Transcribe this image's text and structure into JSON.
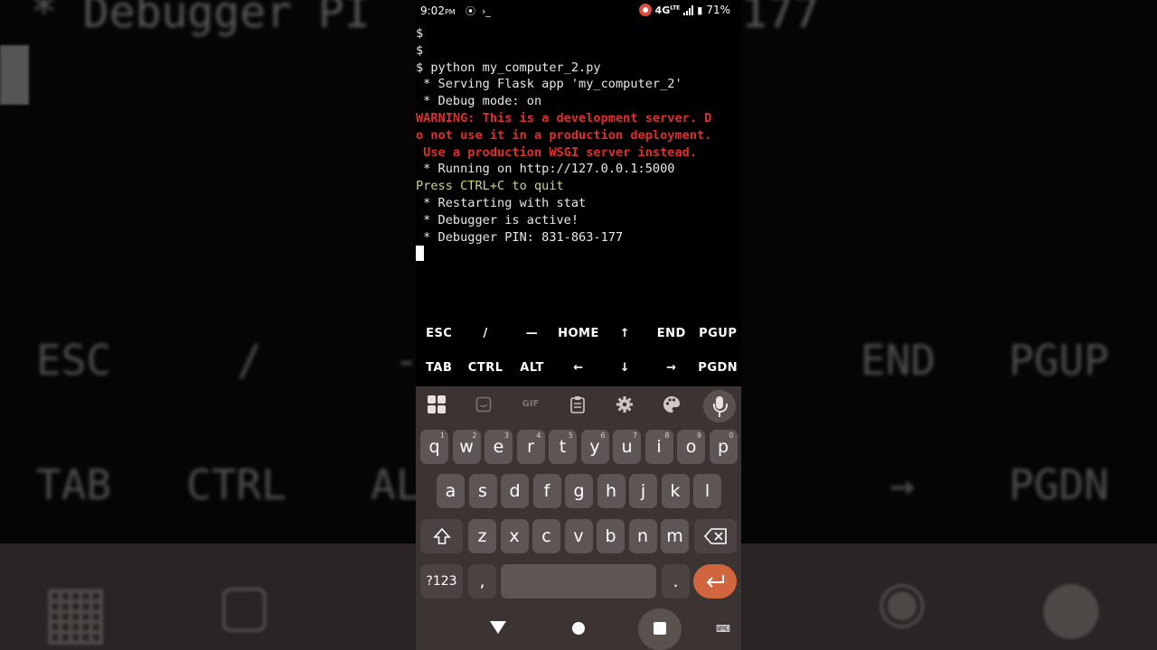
{
  "background": {
    "top_left_text": "* Debugger PI",
    "top_right_text": "177",
    "row1": {
      "esc": "ESC",
      "slash": "/",
      "dash": "-",
      "end": "END",
      "pgup": "PGUP"
    },
    "row2": {
      "tab": "TAB",
      "ctrl": "CTRL",
      "alt": "AL",
      "arrow": "→",
      "pgdn": "PGDN"
    }
  },
  "status_bar": {
    "time": "9:02",
    "ampm": "PM",
    "network": "4G",
    "network_sup": "LTE",
    "battery": "71%"
  },
  "terminal": {
    "lines": [
      {
        "text": "$",
        "style": "normal"
      },
      {
        "text": "$",
        "style": "normal"
      },
      {
        "text": "$ python my_computer_2.py",
        "style": "normal"
      },
      {
        "text": " * Serving Flask app 'my_computer_2'",
        "style": "normal"
      },
      {
        "text": " * Debug mode: on",
        "style": "normal"
      },
      {
        "text": "WARNING: This is a development server. D",
        "style": "warn"
      },
      {
        "text": "o not use it in a production deployment.",
        "style": "warn"
      },
      {
        "text": " Use a production WSGI server instead.",
        "style": "warn"
      },
      {
        "text": " * Running on http://127.0.0.1:5000",
        "style": "normal"
      },
      {
        "text": "Press CTRL+C to quit",
        "style": "yellow"
      },
      {
        "text": " * Restarting with stat",
        "style": "normal"
      },
      {
        "text": " * Debugger is active!",
        "style": "normal"
      },
      {
        "text": " * Debugger PIN: 831-863-177",
        "style": "normal"
      }
    ]
  },
  "extra_keys": {
    "row1": [
      "ESC",
      "/",
      "—",
      "HOME",
      "↑",
      "END",
      "PGUP"
    ],
    "row2": [
      "TAB",
      "CTRL",
      "ALT",
      "←",
      "↓",
      "→",
      "PGDN"
    ]
  },
  "keyboard": {
    "toolbar": {
      "gif": "GIF"
    },
    "row1": [
      {
        "k": "q",
        "n": "1"
      },
      {
        "k": "w",
        "n": "2"
      },
      {
        "k": "e",
        "n": "3"
      },
      {
        "k": "r",
        "n": "4"
      },
      {
        "k": "t",
        "n": "5"
      },
      {
        "k": "y",
        "n": "6"
      },
      {
        "k": "u",
        "n": "7"
      },
      {
        "k": "i",
        "n": "8"
      },
      {
        "k": "o",
        "n": "9"
      },
      {
        "k": "p",
        "n": "0"
      }
    ],
    "row2": [
      "a",
      "s",
      "d",
      "f",
      "g",
      "h",
      "j",
      "k",
      "l"
    ],
    "row3": [
      "z",
      "x",
      "c",
      "v",
      "b",
      "n",
      "m"
    ],
    "symbols_key": "?123",
    "comma_key": ",",
    "period_key": ".",
    "enter_color": "#d0653f"
  }
}
